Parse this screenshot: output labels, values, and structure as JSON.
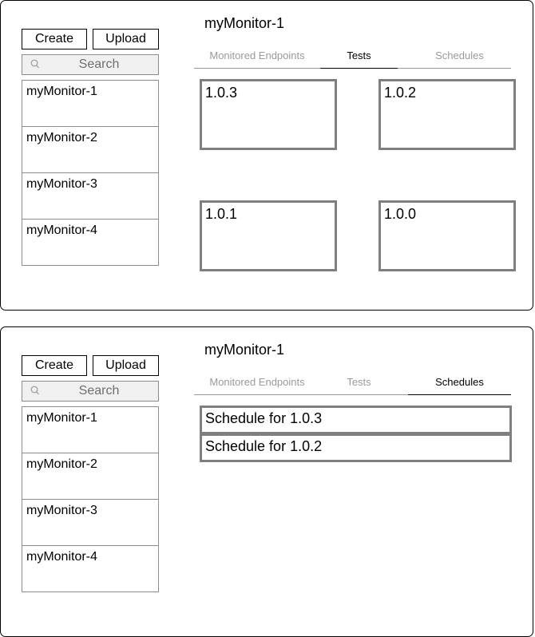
{
  "views": [
    {
      "toolbar": {
        "create_label": "Create",
        "upload_label": "Upload"
      },
      "search": {
        "placeholder": "Search",
        "icon": "search-icon"
      },
      "monitors": [
        {
          "label": "myMonitor-1"
        },
        {
          "label": "myMonitor-2"
        },
        {
          "label": "myMonitor-3"
        },
        {
          "label": "myMonitor-4"
        }
      ],
      "title": "myMonitor-1",
      "tabs": [
        {
          "label": "Monitored Endpoints",
          "active": false
        },
        {
          "label": "Tests",
          "active": true
        },
        {
          "label": "Schedules",
          "active": false
        }
      ],
      "tests": [
        {
          "version": "1.0.3"
        },
        {
          "version": "1.0.2"
        },
        {
          "version": "1.0.1"
        },
        {
          "version": "1.0.0"
        }
      ]
    },
    {
      "toolbar": {
        "create_label": "Create",
        "upload_label": "Upload"
      },
      "search": {
        "placeholder": "Search",
        "icon": "search-icon"
      },
      "monitors": [
        {
          "label": "myMonitor-1"
        },
        {
          "label": "myMonitor-2"
        },
        {
          "label": "myMonitor-3"
        },
        {
          "label": "myMonitor-4"
        }
      ],
      "title": "myMonitor-1",
      "tabs": [
        {
          "label": "Monitored Endpoints",
          "active": false
        },
        {
          "label": "Tests",
          "active": false
        },
        {
          "label": "Schedules",
          "active": true
        }
      ],
      "schedules": [
        {
          "label": "Schedule for 1.0.3"
        },
        {
          "label": "Schedule for 1.0.2"
        }
      ]
    }
  ],
  "colors": {
    "border": "#000000",
    "card_border": "#7f7f7f",
    "tab_inactive": "#9a9a9a",
    "search_bg": "#f0f0f0"
  }
}
